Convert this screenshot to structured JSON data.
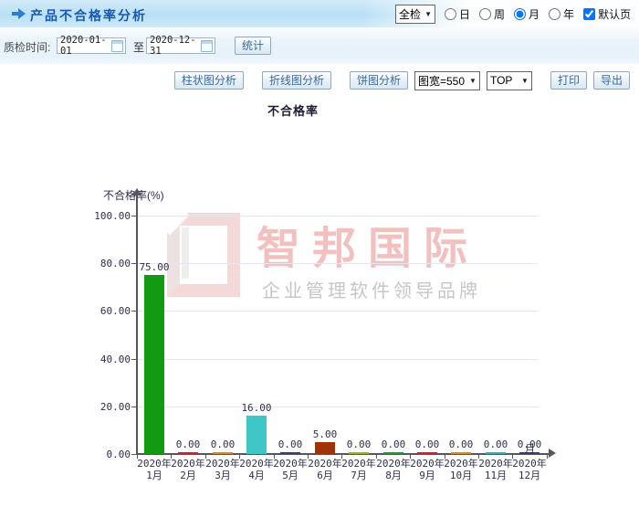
{
  "header": {
    "title": "产品不合格率分析",
    "inspect_type_select": {
      "value": "全检"
    },
    "period_radios": [
      {
        "label": "日",
        "selected": false
      },
      {
        "label": "周",
        "selected": false
      },
      {
        "label": "月",
        "selected": true
      },
      {
        "label": "年",
        "selected": false
      }
    ],
    "default_page_checkbox": {
      "label": "默认页",
      "checked": true
    }
  },
  "filter_bar": {
    "label": "质检时间:",
    "start_date": "2020-01-01",
    "to_label": "至",
    "end_date": "2020-12-31",
    "stat_button": "统计"
  },
  "toolbar": {
    "bar_chart_button": "柱状图分析",
    "line_chart_button": "折线图分析",
    "pie_chart_button": "饼图分析",
    "width_select": "图宽=550",
    "top_select": "TOP",
    "print_button": "打印",
    "export_button": "导出"
  },
  "watermark": {
    "brand": "智邦国际",
    "slogan": "企业管理软件领导品牌"
  },
  "chart_data": {
    "type": "bar",
    "title": "不合格率",
    "ylabel": "不合格率(%)",
    "xlabel": "月",
    "ylim": [
      0,
      100
    ],
    "yticks": [
      0,
      20,
      40,
      60,
      80,
      100
    ],
    "grid": true,
    "legend": null,
    "categories": [
      {
        "year": "2020年",
        "month": "1月"
      },
      {
        "year": "2020年",
        "month": "2月"
      },
      {
        "year": "2020年",
        "month": "3月"
      },
      {
        "year": "2020年",
        "month": "4月"
      },
      {
        "year": "2020年",
        "month": "5月"
      },
      {
        "year": "2020年",
        "month": "6月"
      },
      {
        "year": "2020年",
        "month": "7月"
      },
      {
        "year": "2020年",
        "month": "8月"
      },
      {
        "year": "2020年",
        "month": "9月"
      },
      {
        "year": "2020年",
        "month": "10月"
      },
      {
        "year": "2020年",
        "month": "11月"
      },
      {
        "year": "2020年",
        "month": "12月"
      }
    ],
    "values": [
      75,
      0,
      0,
      16,
      0,
      5,
      0,
      0,
      0,
      0,
      0,
      0
    ],
    "value_labels": [
      "75.00",
      "0.00",
      "0.00",
      "16.00",
      "0.00",
      "5.00",
      "0.00",
      "0.00",
      "0.00",
      "0.00",
      "0.00",
      "0.00"
    ],
    "bar_colors": [
      "#129a12",
      "#cc2233",
      "#e08a1e",
      "#3fc6c6",
      "#3b3b77",
      "#a03408",
      "#9cb51e",
      "#219a32",
      "#cc2233",
      "#e08a1e",
      "#2fb0c4",
      "#3b3b77"
    ]
  }
}
